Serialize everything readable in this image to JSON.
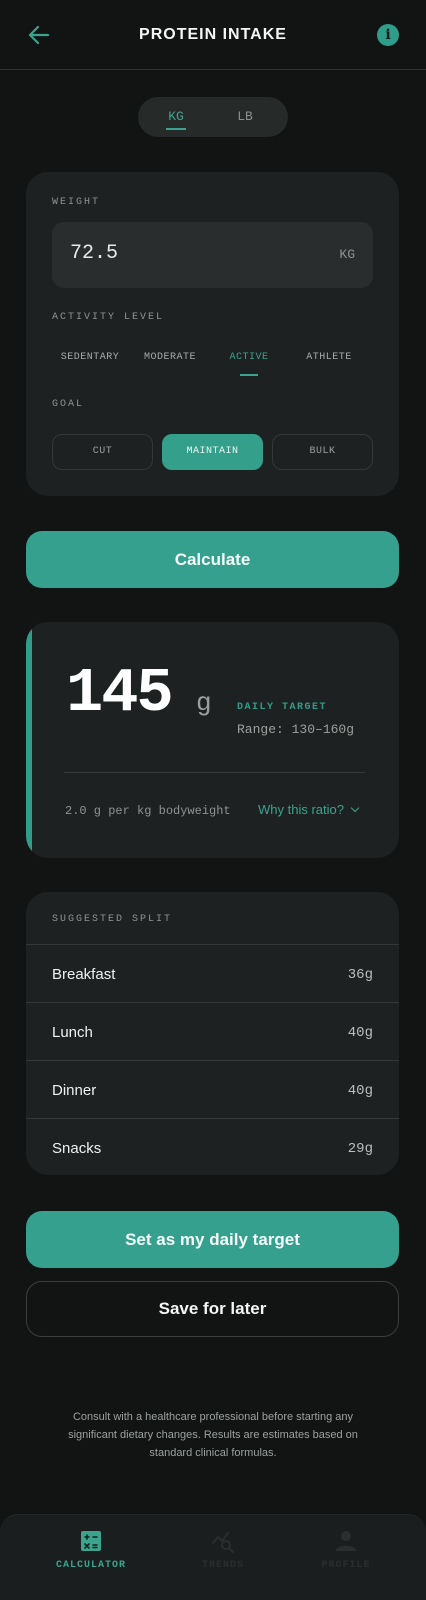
{
  "header": {
    "title": "PROTEIN INTAKE",
    "back_icon": "arrow-left-icon",
    "info_icon": "info-icon",
    "info_glyph": "i"
  },
  "units": {
    "options": [
      "KG",
      "LB"
    ],
    "selected": "KG"
  },
  "form": {
    "weight_label": "WEIGHT",
    "weight_value": "72.5",
    "weight_unit": "KG",
    "activity_label": "ACTIVITY LEVEL",
    "activity_options": [
      "SEDENTARY",
      "MODERATE",
      "ACTIVE",
      "ATHLETE"
    ],
    "activity_selected": "ACTIVE",
    "goal_label": "GOAL",
    "goal_options": [
      "CUT",
      "MAINTAIN",
      "BULK"
    ],
    "goal_selected": "MAINTAIN"
  },
  "calculate_label": "Calculate",
  "result": {
    "value": "145",
    "unit": "g",
    "target_label": "DAILY TARGET",
    "range": "Range: 130–160g",
    "ratio": "2.0 g per kg bodyweight",
    "why_link": "Why this ratio?"
  },
  "split": {
    "label": "SUGGESTED SPLIT",
    "rows": [
      {
        "name": "Breakfast",
        "value": "36g"
      },
      {
        "name": "Lunch",
        "value": "40g"
      },
      {
        "name": "Dinner",
        "value": "40g"
      },
      {
        "name": "Snacks",
        "value": "29g"
      }
    ]
  },
  "actions": {
    "primary": "Set as my daily target",
    "secondary": "Save for later"
  },
  "disclaimer": "Consult with a healthcare professional before starting any significant dietary changes. Results are estimates based on standard clinical formulas.",
  "nav": {
    "items": [
      {
        "label": "CALCULATOR",
        "icon": "calculator-icon",
        "active": true
      },
      {
        "label": "TRENDS",
        "icon": "trends-icon",
        "active": false
      },
      {
        "label": "PROFILE",
        "icon": "profile-icon",
        "active": false
      }
    ]
  },
  "colors": {
    "accent": "#35a08d",
    "background": "#121414",
    "card": "#1e2121"
  }
}
